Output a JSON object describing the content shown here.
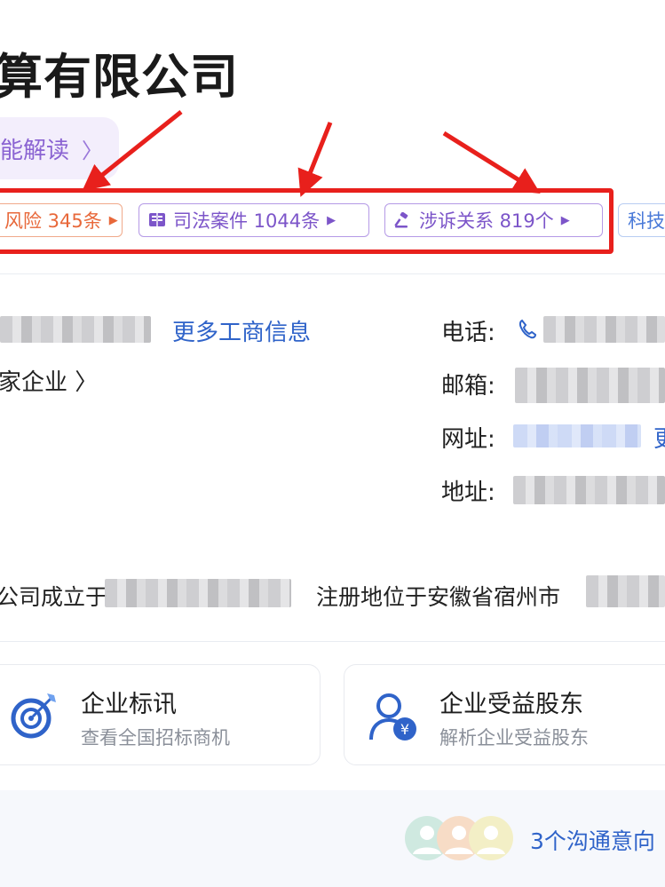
{
  "company": {
    "title": "算有限公司"
  },
  "ai_reading": {
    "label": "能解读",
    "chevron": "〉"
  },
  "tags": {
    "risk": {
      "label": "风险 345条",
      "arrow": "▶"
    },
    "judicial": {
      "label": "司法案件 1044条",
      "arrow": "▶"
    },
    "litigation": {
      "label": "涉诉关系 819个",
      "arrow": "▶"
    },
    "tech": {
      "label": "科技"
    }
  },
  "business": {
    "more_info": "更多工商信息",
    "family": "家企业",
    "family_chevron": "〉"
  },
  "contact": {
    "phone_label": "电话:",
    "email_label": "邮箱:",
    "website_label": "网址:",
    "website_more": "更",
    "address_label": "地址:"
  },
  "intro": {
    "part1": "公司成立于",
    "part2": "注册地位于安徽省宿州市"
  },
  "cards": [
    {
      "title": "企业标讯",
      "subtitle": "查看全国招标商机",
      "icon": "target-icon"
    },
    {
      "title": "企业受益股东",
      "subtitle": "解析企业受益股东",
      "icon": "shareholder-icon"
    }
  ],
  "communication": {
    "label": "3个沟通意向"
  },
  "colors": {
    "annotation_red": "#e8201c",
    "purple": "#7c55c9",
    "orange": "#e8683a",
    "link_blue": "#2f63c9"
  }
}
